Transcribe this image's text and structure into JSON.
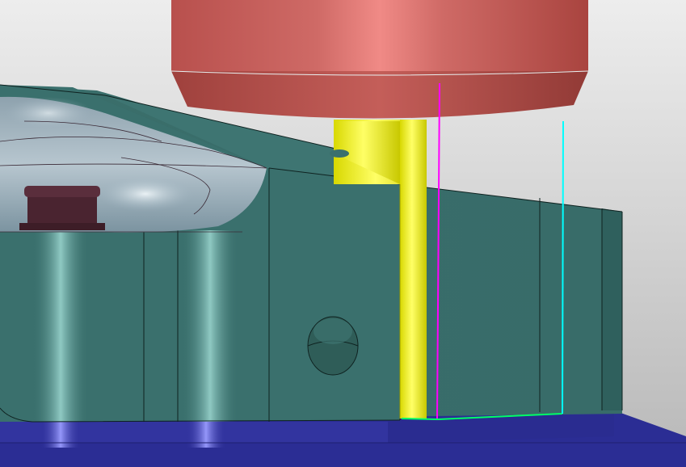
{
  "viewport": {
    "background": {
      "top": "#ececec",
      "bottom": "#b9b9b9"
    }
  },
  "scene": {
    "spindle": {
      "color": "#c9625d",
      "highlight": "#f08a86"
    },
    "tool": {
      "color": "#e4e400",
      "highlight": "#ffff55"
    },
    "fixture_block": {
      "color": "#3b716e",
      "highlight": "#a8e8e0"
    },
    "part_top_surface": {
      "color": "#7e97a4",
      "highlight": "#d7e3ea"
    },
    "base_plate": {
      "color": "#2c2e96",
      "highlight": "#8a8cff"
    },
    "clamp_nut": {
      "color": "#4a2430"
    },
    "side_hole": {
      "color": "#2f5d58"
    },
    "toolpath_lead": {
      "color": "#ff00ff"
    },
    "toolpath_cut": {
      "color": "#00ff66"
    },
    "toolpath_retract": {
      "color": "#00ffff"
    }
  }
}
